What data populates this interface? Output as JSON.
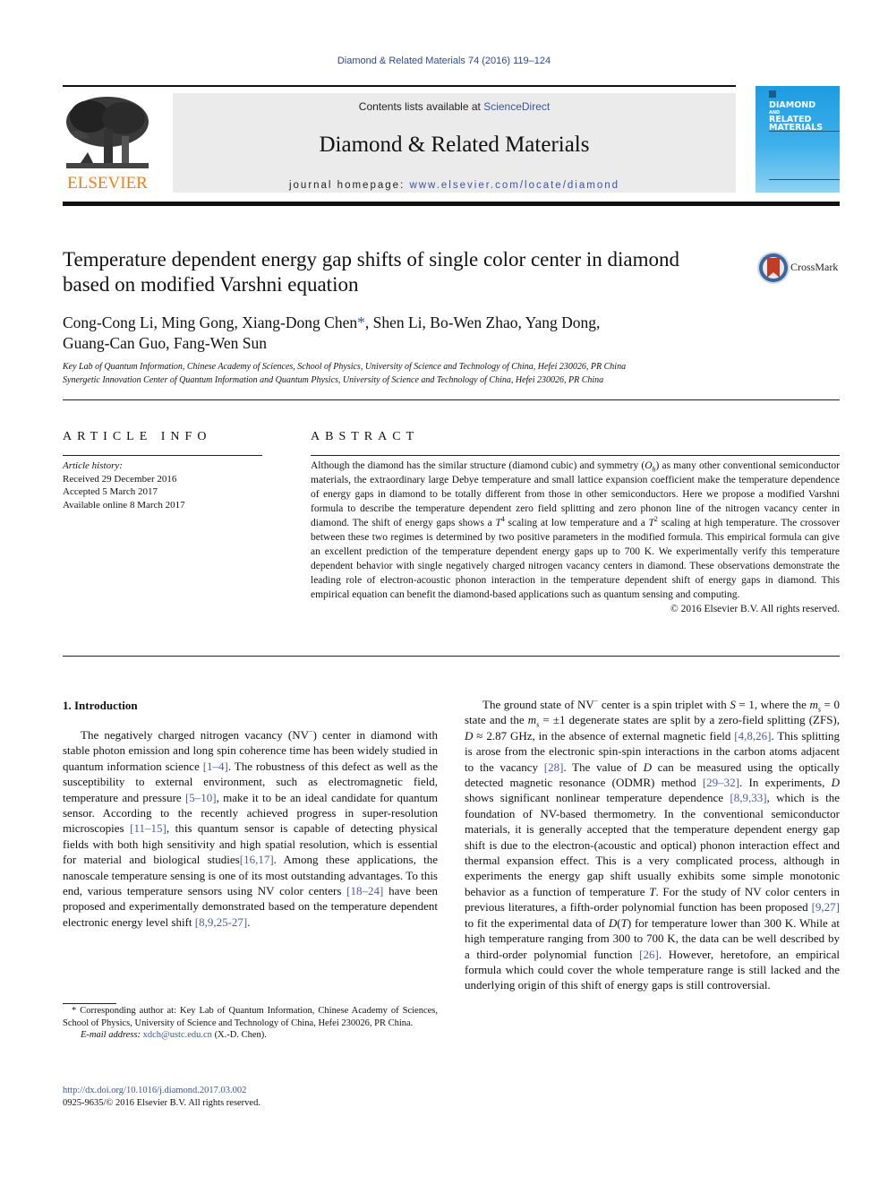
{
  "header": {
    "running_head": "Diamond & Related Materials 74 (2016) 119–124",
    "contents_prefix": "Contents lists available at ",
    "contents_link": "ScienceDirect",
    "journal_title": "Diamond & Related Materials",
    "homepage_prefix": "journal homepage: ",
    "homepage_link": "www.elsevier.com/locate/diamond",
    "publisher_logo_text": "ELSEVIER",
    "cover": {
      "line1": "DIAMOND",
      "line2": "AND",
      "line3": "RELATED",
      "line4": "MATERIALS"
    },
    "crossmark_label": "CrossMark",
    "colors": {
      "elsevier_orange": "#f07f1a",
      "link_blue": "#3b55a0",
      "cover_blue": "#1d9ce0"
    }
  },
  "article": {
    "title": "Temperature dependent energy gap shifts of single color center in diamond based on modified Varshni equation",
    "authors_part1": "Cong-Cong Li, Ming Gong, Xiang-Dong Chen",
    "author_mark": "*",
    "authors_part2": ", Shen Li, Bo-Wen Zhao, Yang Dong,",
    "authors_line2": "Guang-Can Guo, Fang-Wen Sun",
    "affiliations": [
      "Key Lab of Quantum Information, Chinese Academy of Sciences, School of Physics, University of Science and Technology of China, Hefei 230026, PR China",
      "Synergetic Innovation Center of Quantum Information and Quantum Physics, University of Science and Technology of China, Hefei 230026, PR China"
    ]
  },
  "article_info": {
    "heading": "ARTICLE INFO",
    "history_label": "Article history:",
    "received": "Received 29 December 2016",
    "accepted": "Accepted 5 March 2017",
    "online": "Available online 8 March 2017"
  },
  "abstract": {
    "heading": "ABSTRACT",
    "s1a": "Although the diamond has the similar structure (diamond cubic) and symmetry (",
    "sym": "O",
    "sym_sub": "h",
    "s1b": ") as many other conventional semiconductor materials, the extraordinary large Debye temperature and small lattice expansion coefficient make the temperature dependence of energy gaps in diamond to be totally different from those in other semiconductors. Here we propose a modified Varshni formula to describe the temperature dependent zero field splitting and zero phonon line of the nitrogen vacancy center in diamond. The shift of energy gaps shows a ",
    "t4_base": "T",
    "t4_exp": "4",
    "s2": " scaling at low temperature and a ",
    "t2_base": "T",
    "t2_exp": "2",
    "s3": " scaling at high temperature. The crossover between these two regimes is determined by two positive parameters in the modified formula. This empirical formula can give an excellent prediction of the temperature dependent energy gaps up to 700 K. We experimentally verify this temperature dependent behavior with single negatively charged nitrogen vacancy centers in diamond. These observations demonstrate the leading role of electron-acoustic phonon interaction in the temperature dependent shift of energy gaps in diamond. This empirical equation can benefit the diamond-based applications such as quantum sensing and computing.",
    "copyright": "© 2016 Elsevier B.V. All rights reserved."
  },
  "intro": {
    "heading": "1. Introduction",
    "p1": [
      {
        "t": "The negatively charged nitrogen vacancy (NV"
      },
      {
        "sup": "−"
      },
      {
        "t": ") center in diamond with stable photon emission and long spin coherence time has been widely studied in quantum information science "
      },
      {
        "cite": "[1–4]"
      },
      {
        "t": ". The robustness of this defect as well as the susceptibility to external environment, such as electromagnetic field, temperature and pressure "
      },
      {
        "cite": "[5–10]"
      },
      {
        "t": ", make it to be an ideal candidate for quantum sensor. According to the recently achieved progress in super-resolution microscopies "
      },
      {
        "cite": "[11–15]"
      },
      {
        "t": ", this quantum sensor is capable of detecting physical fields with both high sensitivity and high spatial resolution, which is essential for material and biological studies"
      },
      {
        "cite": "[16,17]"
      },
      {
        "t": ". Among these applications, the nanoscale temperature sensing is one of its most outstanding advantages. To this end, various temperature sensors using NV color centers "
      },
      {
        "cite": "[18–24]"
      },
      {
        "t": " have been proposed and experimentally demonstrated based on the temperature dependent electronic energy level shift "
      },
      {
        "cite": "[8,9,25-27]"
      },
      {
        "t": "."
      }
    ],
    "p2": [
      {
        "t": "The ground state of NV"
      },
      {
        "sup": "−"
      },
      {
        "t": " center is a spin triplet with "
      },
      {
        "i": "S"
      },
      {
        "t": " = 1, where the "
      },
      {
        "i": "m"
      },
      {
        "sub": "s"
      },
      {
        "t": " = 0 state and the "
      },
      {
        "i": "m"
      },
      {
        "sub": "s"
      },
      {
        "t": " = ±1 degenerate states are split by a zero-field splitting (ZFS), "
      },
      {
        "i": "D"
      },
      {
        "t": " ≈ 2.87 GHz, in the absence of external magnetic field "
      },
      {
        "cite": "[4,8,26]"
      },
      {
        "t": ". This splitting is arose from the electronic spin-spin interactions in the carbon atoms adjacent to the vacancy "
      },
      {
        "cite": "[28]"
      },
      {
        "t": ". The value of "
      },
      {
        "i": "D"
      },
      {
        "t": " can be measured using the optically detected magnetic resonance (ODMR) method "
      },
      {
        "cite": "[29–32]"
      },
      {
        "t": ". In experiments, "
      },
      {
        "i": "D"
      },
      {
        "t": " shows significant nonlinear temperature dependence "
      },
      {
        "cite": "[8,9,33]"
      },
      {
        "t": ", which is the foundation of NV-based thermometry. In the conventional semiconductor materials, it is generally accepted that the temperature dependent energy gap shift is due to the electron-(acoustic and optical) phonon interaction effect and thermal expansion effect. This is a very complicated process, although in experiments the energy gap shift usually exhibits some simple monotonic behavior as a function of temperature "
      },
      {
        "i": "T"
      },
      {
        "t": ". For the study of NV color centers in previous literatures, a fifth-order polynomial function has been proposed "
      },
      {
        "cite": "[9,27]"
      },
      {
        "t": " to fit the experimental data of "
      },
      {
        "i": "D"
      },
      {
        "t": "("
      },
      {
        "i": "T"
      },
      {
        "t": ") for temperature lower than 300 K. While at high temperature ranging from 300 to 700 K, the data can be well described by a third-order polynomial function "
      },
      {
        "cite": "[26]"
      },
      {
        "t": ". However, heretofore, an empirical formula which could cover the whole temperature range is still lacked and the underlying origin of this shift of energy gaps is still controversial."
      }
    ]
  },
  "footnote": {
    "mark": "*",
    "corresponding": " Corresponding author at: Key Lab of Quantum Information, Chinese Academy of Sciences, School of Physics, University of Science and Technology of China, Hefei 230026, PR China.",
    "email_label": "E-mail address:",
    "email": "xdch@ustc.edu.cn",
    "email_suffix": " (X.-D. Chen).",
    "doi": "http://dx.doi.org/10.1016/j.diamond.2017.03.002",
    "issn_line": "0925-9635/© 2016 Elsevier B.V. All rights reserved."
  }
}
